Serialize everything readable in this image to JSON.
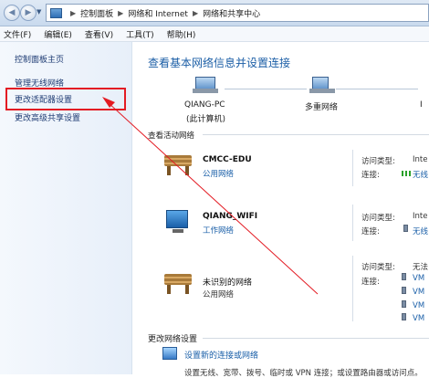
{
  "address_bar": {
    "crumbs": [
      "控制面板",
      "网络和 Internet",
      "网络和共享中心"
    ],
    "back_glyph": "◀",
    "forward_glyph": "▶",
    "dropdown_glyph": "▼",
    "sep_glyph": "▶"
  },
  "menu": [
    "文件(F)",
    "编辑(E)",
    "查看(V)",
    "工具(T)",
    "帮助(H)"
  ],
  "sidebar": {
    "items": [
      "控制面板主页",
      "管理无线网络",
      "更改适配器设置",
      "更改高级共享设置"
    ],
    "highlight_color": "#e31b23"
  },
  "main": {
    "title": "查看基本网络信息并设置连接",
    "map": {
      "pc_name": "QIANG-PC",
      "pc_sub": "(此计算机)",
      "multi_net": "多重网络",
      "internet_cut": "I"
    },
    "active_title": "查看活动网络",
    "networks": [
      {
        "name": "CMCC-EDU",
        "type": "公用网络",
        "access_label": "访问类型:",
        "access_value": "Inte",
        "conn_label": "连接:",
        "conn_value": "无线"
      },
      {
        "name": "QIANG_WIFI",
        "type": "工作网络",
        "access_label": "访问类型:",
        "access_value": "Inte",
        "conn_label": "连接:",
        "conn_value": "无线"
      },
      {
        "name": "未识别的网络",
        "type": "公用网络",
        "access_label": "访问类型:",
        "access_value": "无法",
        "conn_label": "连接:",
        "conn_values": [
          "VM",
          "VM",
          "VM",
          "VM"
        ]
      }
    ],
    "change_title": "更改网络设置",
    "change_link": "设置新的连接或网络",
    "change_desc": "设置无线、宽带、拨号、临时或 VPN 连接；或设置路由器或访问点。"
  },
  "colors": {
    "link": "#1a5fa8",
    "title": "#1b5ea6",
    "annotation_red": "#e31b23"
  }
}
